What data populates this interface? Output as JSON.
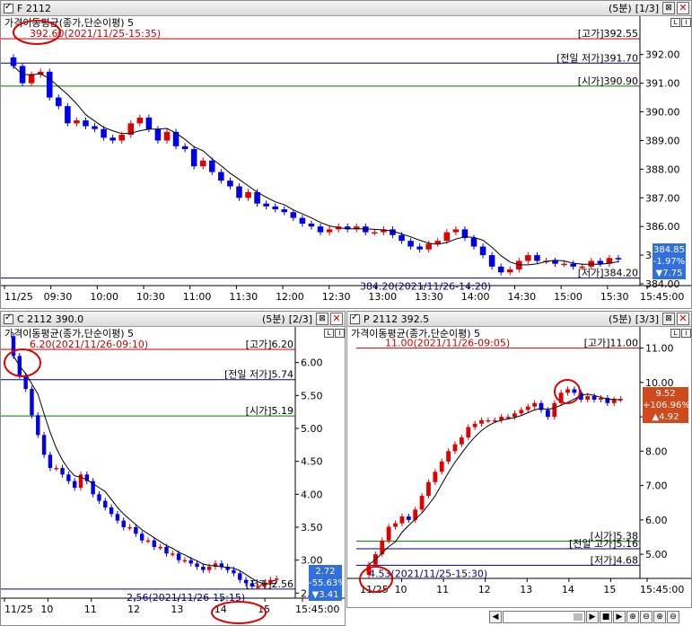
{
  "panels": [
    {
      "title": "F 2112",
      "period": "(5분)",
      "page": "[1/3]",
      "indicator_label": "가격이동평균(종가,단순이평)",
      "indicator_period": "5",
      "max_label": "392.60(2021/11/25-15:35)",
      "min_label": "384.20(2021/11/26-14:20)",
      "levels": [
        {
          "label": "[고가]392.55",
          "value": 392.55,
          "color": "#cc0000"
        },
        {
          "label": "[전일 저가]391.70",
          "value": 391.7,
          "color": "#000080"
        },
        {
          "label": "[시가]390.90",
          "value": 390.9,
          "color": "#007700"
        },
        {
          "label": "[저가]384.20",
          "value": 384.2,
          "color": "#000080"
        }
      ],
      "price_box": {
        "price": "384.85",
        "pct": "-1.97%",
        "chg": "▼7.75",
        "color": "#2f6fe0"
      },
      "y_ticks": [
        "392.00",
        "391.00",
        "390.00",
        "389.00",
        "388.00",
        "387.00",
        "386.00",
        "385.00",
        "384.00"
      ],
      "x_ticks": [
        "11/25",
        "09:30",
        "10:00",
        "10:30",
        "11:00",
        "11:30",
        "12:00",
        "12:30",
        "13:00",
        "13:30",
        "14:00",
        "14:30",
        "15:00",
        "15:30",
        "15:45:00"
      ]
    },
    {
      "title": "C 2112 390.0",
      "period": "(5분)",
      "page": "[2/3]",
      "indicator_label": "가격이동평균(종가,단순이평)",
      "indicator_period": "5",
      "max_label": "6.20(2021/11/26-09:10)",
      "min_label": "2.56(2021/11/26-15:15)",
      "levels": [
        {
          "label": "[고가]6.20",
          "value": 6.2,
          "color": "#cc0000"
        },
        {
          "label": "[전일 저가]5.74",
          "value": 5.74,
          "color": "#000080"
        },
        {
          "label": "[시가]5.19",
          "value": 5.19,
          "color": "#007700"
        },
        {
          "label": "[저가]2.56",
          "value": 2.56,
          "color": "#000080"
        }
      ],
      "price_box": {
        "price": "2.72",
        "pct": "-55.63%",
        "chg": "▼3.41",
        "color": "#2f6fe0"
      },
      "y_ticks": [
        "6.00",
        "5.50",
        "5.00",
        "4.50",
        "4.00",
        "3.50",
        "3.00",
        "2.50"
      ],
      "x_ticks": [
        "11/25",
        "10",
        "11",
        "12",
        "13",
        "14",
        "15",
        "15:45:00"
      ]
    },
    {
      "title": "P 2112 392.5",
      "period": "(5분)",
      "page": "[3/3]",
      "indicator_label": "가격이동평균(종가,단순이평)",
      "indicator_period": "5",
      "max_label": "11.00(2021/11/26-09:05)",
      "min_label": "4.53(2021/11/25-15:30)",
      "levels": [
        {
          "label": "[고가]11.00",
          "value": 11.0,
          "color": "#cc0000"
        },
        {
          "label": "[시가]5.38",
          "value": 5.38,
          "color": "#007700"
        },
        {
          "label": "[전일 고가]5.16",
          "value": 5.16,
          "color": "#000080"
        },
        {
          "label": "[저가]4.68",
          "value": 4.68,
          "color": "#000080"
        }
      ],
      "price_box": {
        "price": "9.52",
        "pct": "+106.96%",
        "chg": "▲4.92",
        "color": "#d04a1c"
      },
      "y_ticks": [
        "11.00",
        "10.00",
        "9.00",
        "8.00",
        "7.00",
        "6.00",
        "5.00"
      ],
      "x_ticks": [
        "11/25",
        "10",
        "11",
        "12",
        "13",
        "14",
        "15",
        "15:45:00"
      ]
    }
  ],
  "chart_data": [
    {
      "type": "candlestick",
      "series_close": [
        391.6,
        391.0,
        391.3,
        391.4,
        390.5,
        390.2,
        389.6,
        389.7,
        389.5,
        389.4,
        389.1,
        389.0,
        389.2,
        389.6,
        389.8,
        389.4,
        389.0,
        389.3,
        388.8,
        388.7,
        388.1,
        388.3,
        387.9,
        387.6,
        387.4,
        387.0,
        387.2,
        386.8,
        386.7,
        386.6,
        386.5,
        386.3,
        386.1,
        386.0,
        385.8,
        385.9,
        386.0,
        385.9,
        386.0,
        385.8,
        385.8,
        385.9,
        385.7,
        385.5,
        385.3,
        385.2,
        385.4,
        385.5,
        385.8,
        385.9,
        385.6,
        385.3,
        385.0,
        384.6,
        384.4,
        384.5,
        384.8,
        385.0,
        384.8,
        384.8,
        384.7,
        384.7,
        384.6,
        384.6,
        384.8,
        384.7,
        384.9,
        384.85
      ],
      "ylim": [
        384.0,
        392.9
      ]
    },
    {
      "type": "candlestick",
      "series_close": [
        6.1,
        5.8,
        5.6,
        5.2,
        4.9,
        4.6,
        4.4,
        4.4,
        4.3,
        4.2,
        4.1,
        4.3,
        4.2,
        4.0,
        3.9,
        3.8,
        3.7,
        3.6,
        3.5,
        3.5,
        3.4,
        3.3,
        3.3,
        3.2,
        3.2,
        3.1,
        3.1,
        3.0,
        3.0,
        2.95,
        2.9,
        2.85,
        2.9,
        2.95,
        2.9,
        2.85,
        2.8,
        2.7,
        2.65,
        2.6,
        2.6,
        2.65,
        2.7,
        2.72
      ],
      "ylim": [
        2.45,
        6.35
      ]
    },
    {
      "type": "candlestick",
      "series_close": [
        4.7,
        5.0,
        5.4,
        5.8,
        5.9,
        6.1,
        6.0,
        6.3,
        6.7,
        7.1,
        7.4,
        7.7,
        8.0,
        8.2,
        8.4,
        8.7,
        8.8,
        8.9,
        8.9,
        8.9,
        9.0,
        9.0,
        9.1,
        9.2,
        9.3,
        9.4,
        9.2,
        9.0,
        9.4,
        9.7,
        9.8,
        9.7,
        9.5,
        9.6,
        9.5,
        9.55,
        9.4,
        9.5,
        9.52
      ],
      "ylim": [
        4.35,
        11.25
      ]
    }
  ],
  "scrollbar": {
    "buttons": [
      "◀",
      "▶",
      "■",
      "▶",
      "⊕",
      "⊖",
      "⊕",
      "⊖"
    ]
  }
}
